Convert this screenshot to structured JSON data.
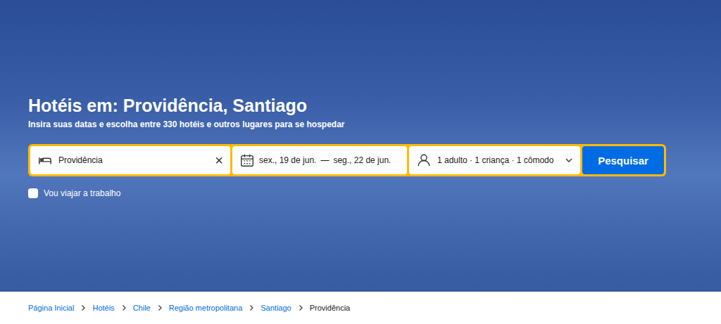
{
  "page": {
    "title": "Hotéis em: Providência, Santiago",
    "subtitle": "Insira suas datas e escolha entre 330 hotéis e outros lugares para se hospedar"
  },
  "search": {
    "destination": "Providência",
    "clear": "×",
    "check_in": "sex., 19 de jun.",
    "separator": "—",
    "check_out": "seg., 22 de jun.",
    "guests": "1 adulto · 1 criança · 1 cômodo",
    "button": "Pesquisar"
  },
  "business_trip": {
    "label": "Vou viajar a trabalho",
    "checked": false
  },
  "breadcrumb": [
    {
      "label": "Página Inicial",
      "current": false
    },
    {
      "label": "Hotéis",
      "current": false
    },
    {
      "label": "Chile",
      "current": false
    },
    {
      "label": "Região metropolitana",
      "current": false
    },
    {
      "label": "Santiago",
      "current": false
    },
    {
      "label": "Providência",
      "current": true
    }
  ]
}
